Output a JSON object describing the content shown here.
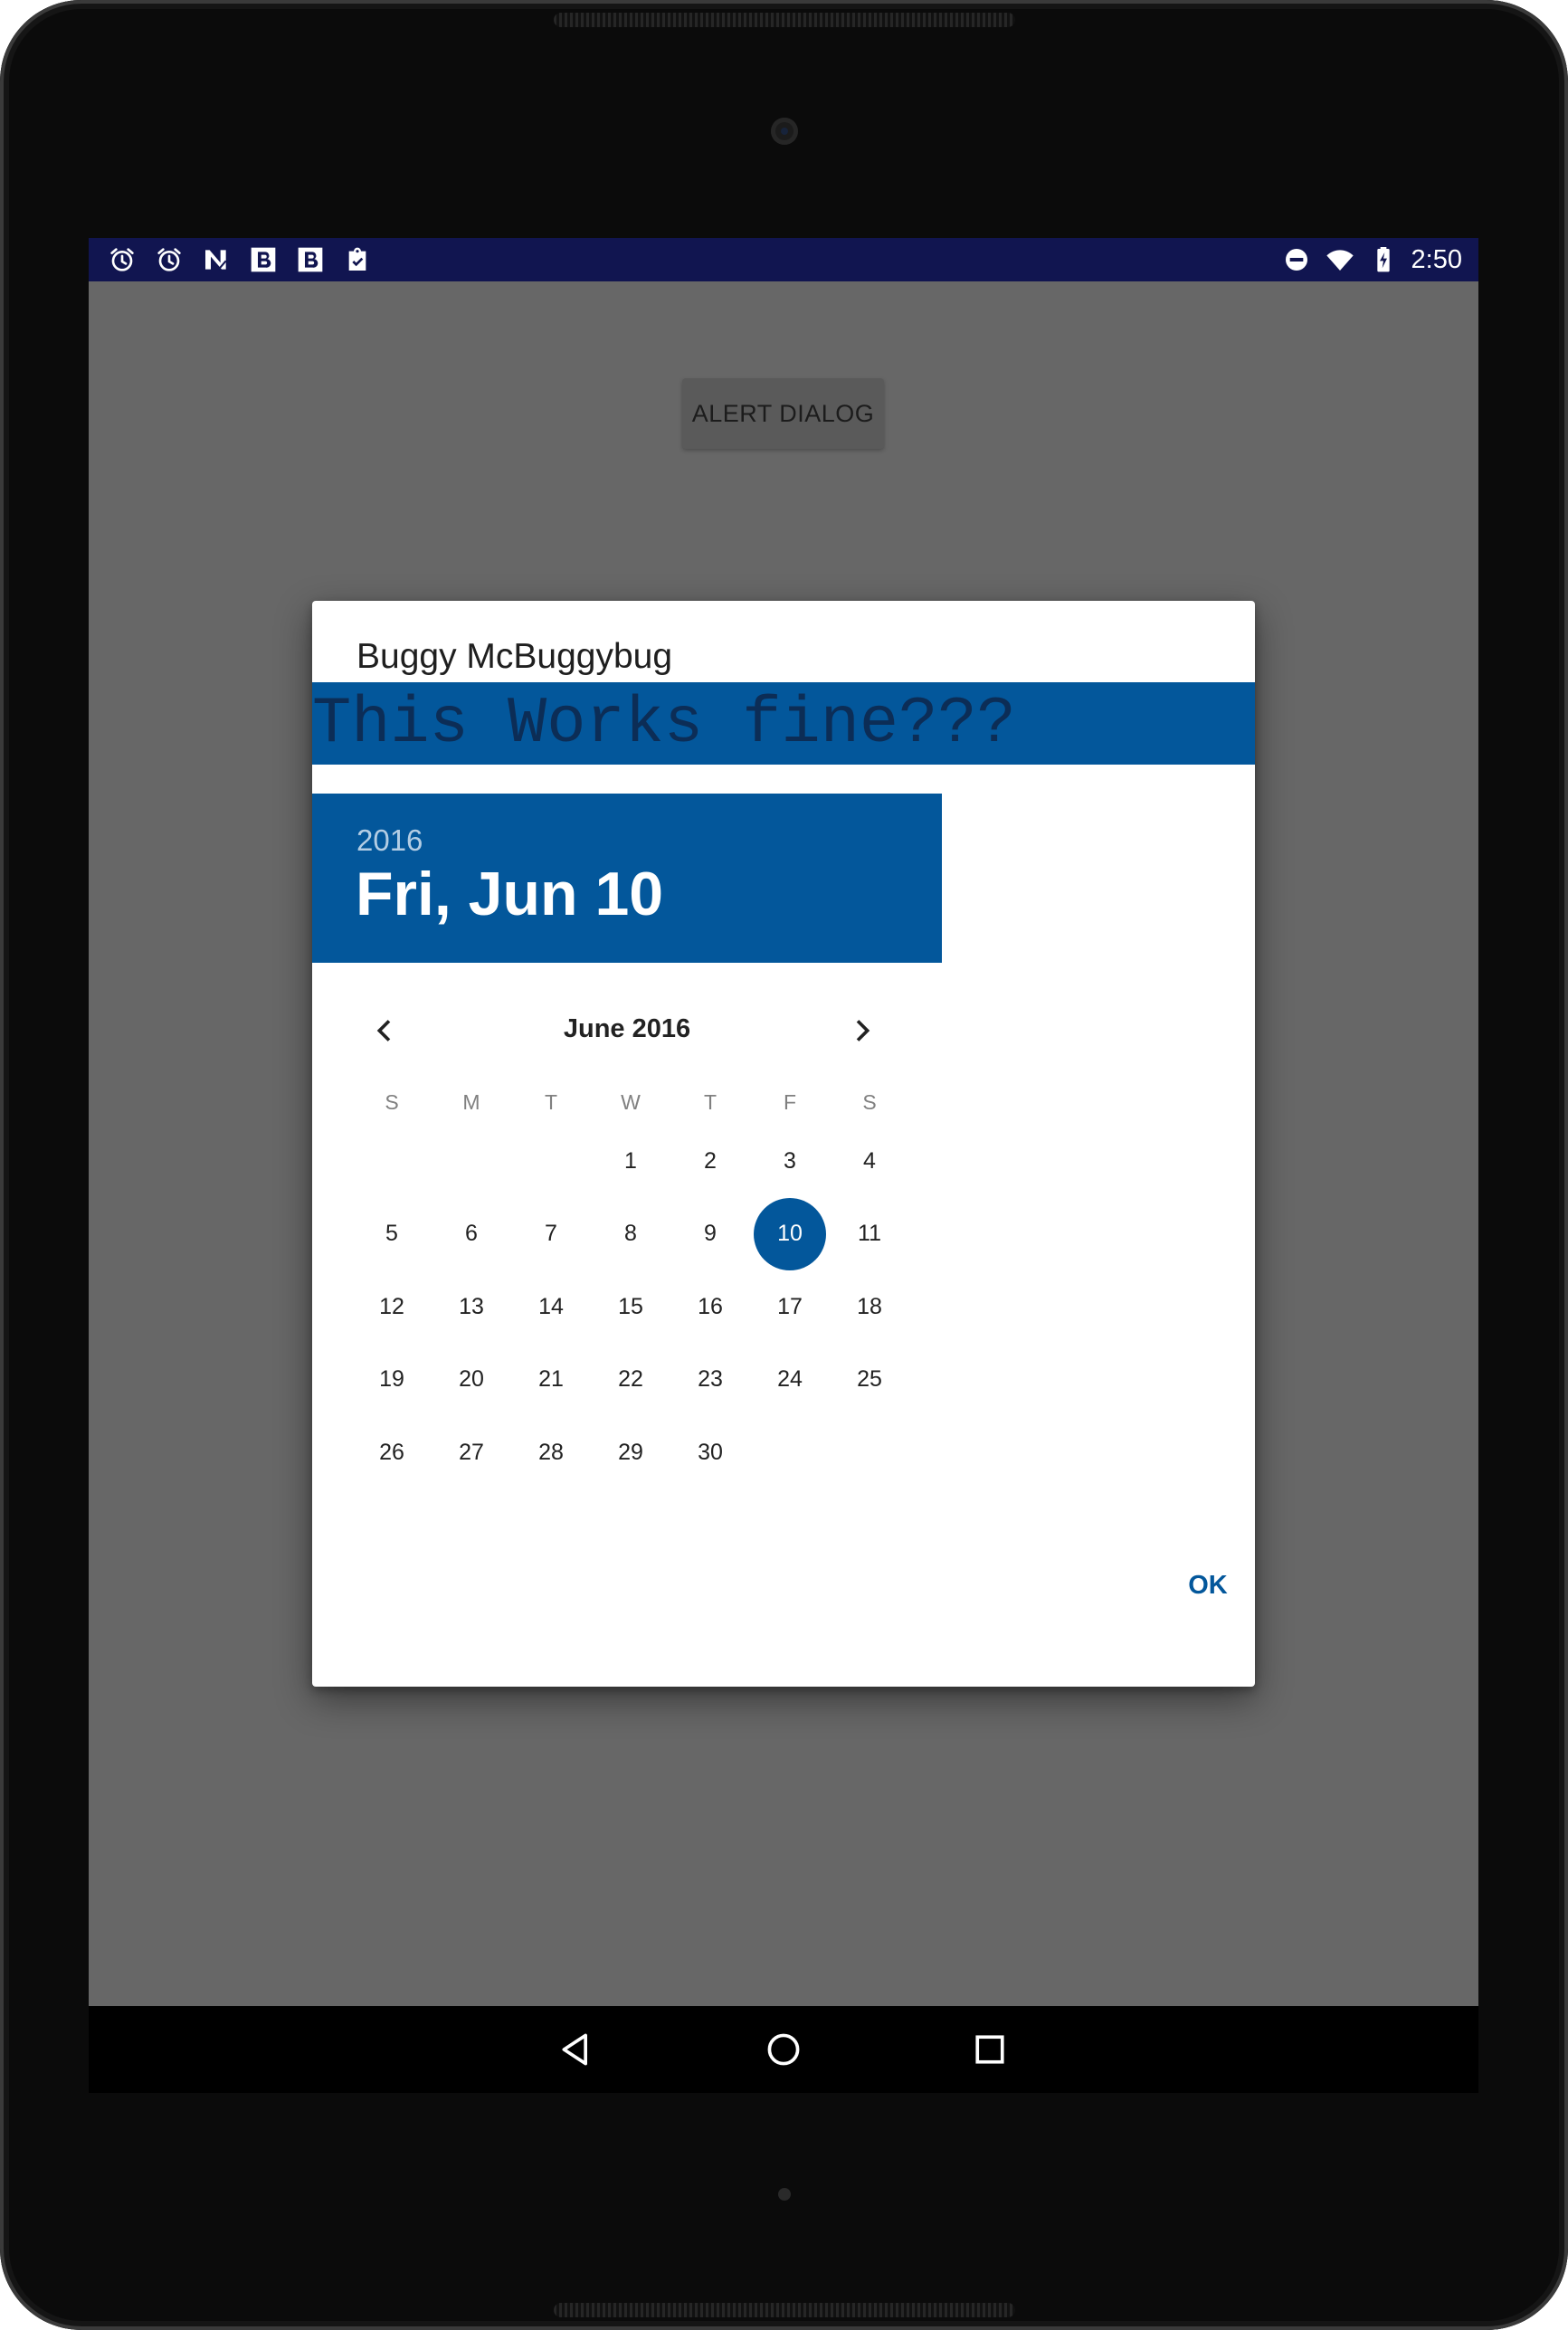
{
  "status_bar": {
    "left_icons": [
      "alarm-icon",
      "alarm-icon",
      "nfc-n-icon",
      "b-app-icon",
      "b-app-icon",
      "clipboard-check-icon"
    ],
    "right_icons": [
      "do-not-disturb-icon",
      "wifi-icon",
      "battery-charging-icon"
    ],
    "time": "2:50"
  },
  "app": {
    "button_label": "ALERT DIALOG"
  },
  "dialog": {
    "title": "Buggy McBuggybug",
    "banner_text": "This Works fine???",
    "header_year": "2016",
    "header_date": "Fri, Jun 10",
    "month_label": "June 2016",
    "weekdays": [
      "S",
      "M",
      "T",
      "W",
      "T",
      "F",
      "S"
    ],
    "first_weekday_index": 3,
    "days_in_month": 30,
    "selected_day": 10,
    "ok_label": "OK"
  },
  "nav_bar": {
    "buttons": [
      "back-icon",
      "home-icon",
      "recents-icon"
    ]
  },
  "colors": {
    "accent": "#03579b",
    "status_bar": "#111550",
    "scrim": "#676767"
  }
}
